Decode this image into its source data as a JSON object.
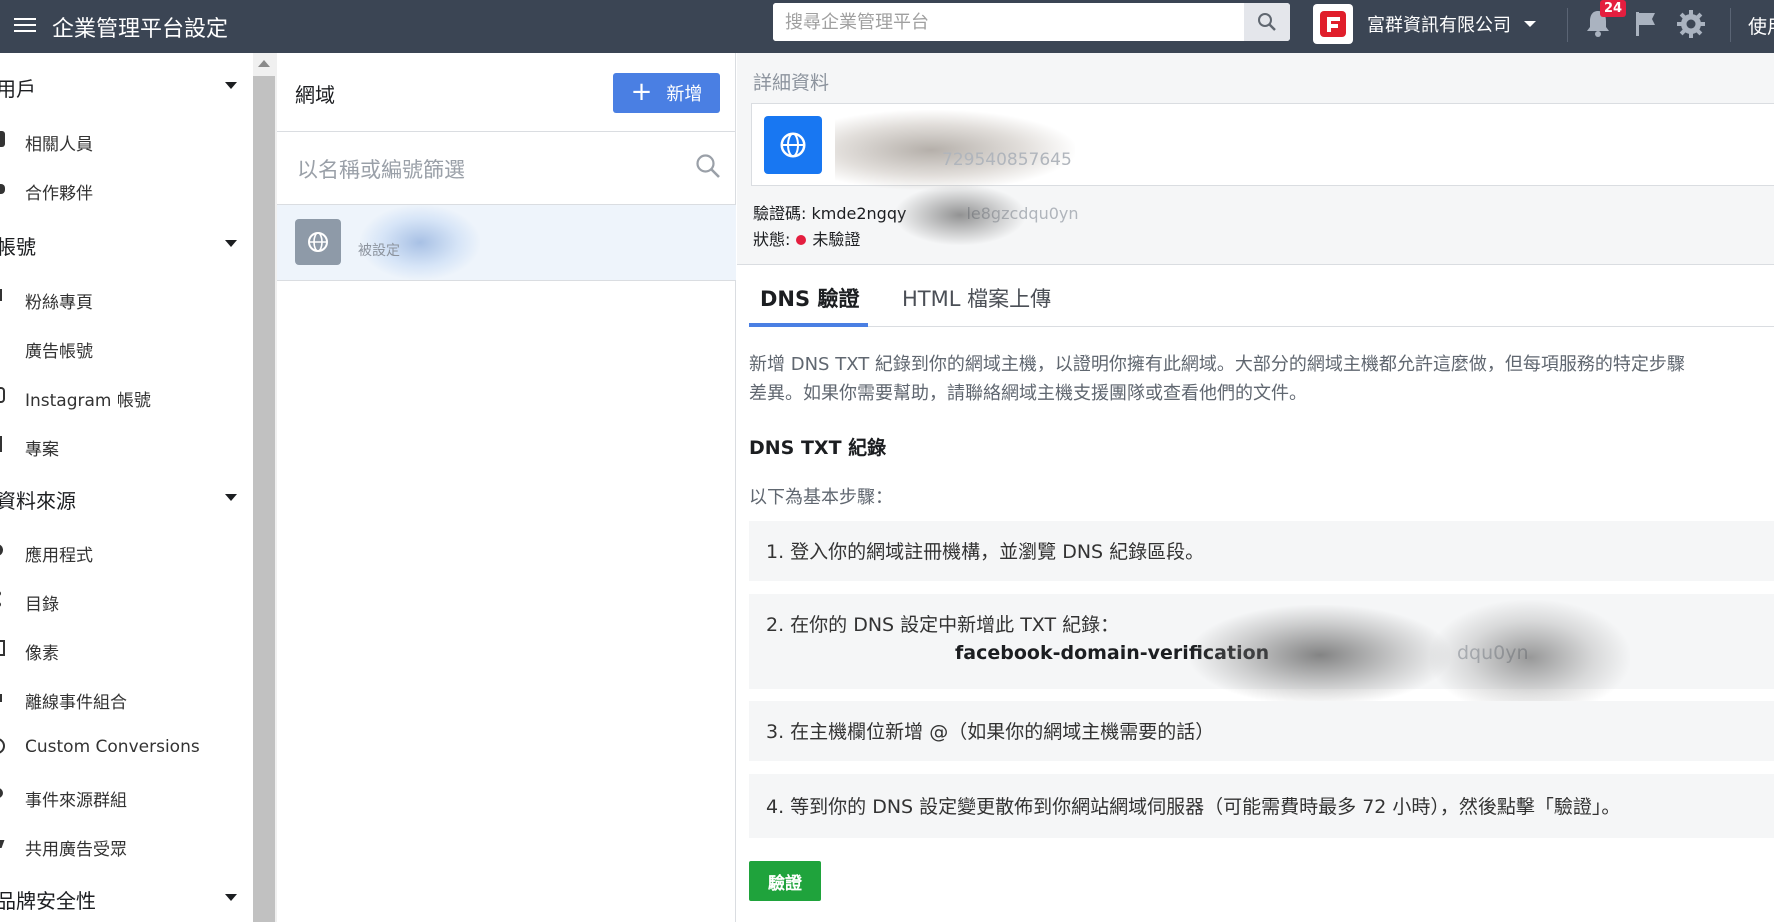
{
  "topbar": {
    "title": "企業管理平台設定",
    "search_placeholder": "搜尋企業管理平台",
    "company_name": "富群資訊有限公司",
    "notification_count": "24",
    "user_label_cut": "使用"
  },
  "sidebar": {
    "sections": [
      {
        "label": "用戶",
        "items": [
          "相關人員",
          "合作夥伴"
        ]
      },
      {
        "label": "帳號",
        "items": [
          "粉絲專頁",
          "廣告帳號",
          "Instagram 帳號",
          "專案"
        ]
      },
      {
        "label": "資料來源",
        "items": [
          "應用程式",
          "目錄",
          "像素",
          "離線事件組合",
          "Custom Conversions",
          "事件來源群組",
          "共用廣告受眾"
        ]
      },
      {
        "label": "品牌安全性",
        "items": []
      }
    ]
  },
  "middle": {
    "title": "網域",
    "add_label": "新增",
    "filter_placeholder": "以名稱或編號篩選",
    "selected_meta": "被設定"
  },
  "detail": {
    "section_label": "詳細資料",
    "domain_id": "729540857645",
    "verify_code_label": "驗證碼:",
    "verify_code_value": "kmde2ngqy",
    "verify_code_tail": "le8gzcdqu0yn",
    "status_label": "狀態:",
    "status_value": "未驗證",
    "status_color": "#e41e3f"
  },
  "tabs": {
    "dns": "DNS 驗證",
    "html": "HTML 檔案上傳"
  },
  "content": {
    "intro_line1": "新增 DNS TXT 紀錄到你的網域主機，以證明你擁有此網域。大部分的網域主機都允許這麼做，但每項服務的特定步驟",
    "intro_line2": "差異。如果你需要幫助，請聯絡網域主機支援團隊或查看他們的文件。",
    "heading": "DNS TXT 紀錄",
    "steps_intro": "以下為基本步驟：",
    "step1": "1. 登入你的網域註冊機構，並瀏覽 DNS 紀錄區段。",
    "step2": "2. 在你的 DNS 設定中新增此 TXT 紀錄：",
    "step2_code": "facebook-domain-verification",
    "step2_code_tail": "dqu0yn",
    "step3": "3. 在主機欄位新增 @（如果你的網域主機需要的話）",
    "step4": "4. 等到你的 DNS 設定變更散佈到你網站網域伺服器（可能需費時最多 72 小時），然後點擊「驗證」。",
    "verify_button": "驗證"
  },
  "colors": {
    "topbar": "#3b4554",
    "primary": "#4a7fe3",
    "verify": "#1fa33c",
    "facebook_blue": "#1877f2"
  }
}
